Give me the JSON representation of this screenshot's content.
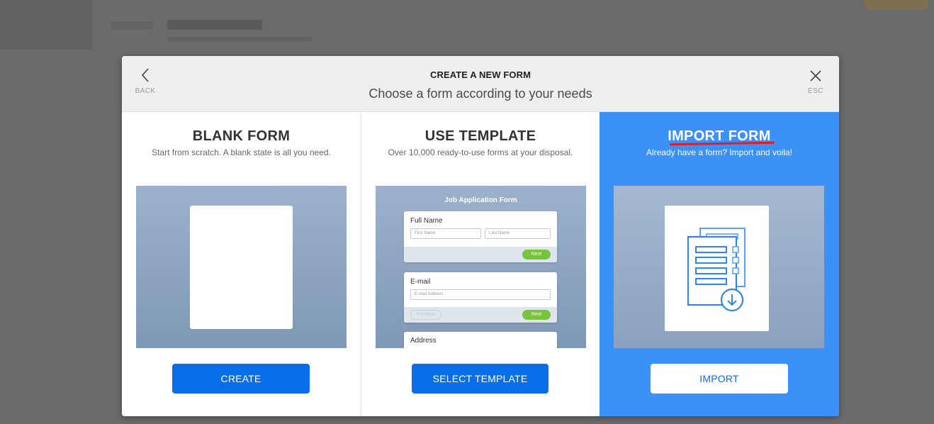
{
  "modal": {
    "back_label": "BACK",
    "esc_label": "ESC",
    "title": "CREATE A NEW FORM",
    "subtitle": "Choose a form according to your needs"
  },
  "options": [
    {
      "title": "BLANK FORM",
      "description": "Start from scratch. A blank state is all you need.",
      "button_label": "CREATE"
    },
    {
      "title": "USE TEMPLATE",
      "description": "Over 10,000 ready-to-use forms at your disposal.",
      "button_label": "SELECT TEMPLATE",
      "preview": {
        "form_title": "Job Application Form",
        "cards": [
          {
            "label": "Full Name",
            "fields": [
              "First Name",
              "Last Name"
            ],
            "next": "Next"
          },
          {
            "label": "E-mail",
            "fields": [
              "E-mail Address"
            ],
            "previous": "Previous",
            "next": "Next"
          },
          {
            "label": "Address"
          }
        ]
      }
    },
    {
      "title": "IMPORT FORM",
      "description": "Already have a form? Import and voila!",
      "button_label": "IMPORT",
      "selected": true
    }
  ],
  "colors": {
    "accent_blue": "#0a6ee8",
    "selected_column": "#3b91f7",
    "annotation_underline": "#e11d1d",
    "next_button_green": "#78c43a"
  },
  "icons": [
    "chevron-left-icon",
    "close-icon",
    "import-documents-icon"
  ]
}
